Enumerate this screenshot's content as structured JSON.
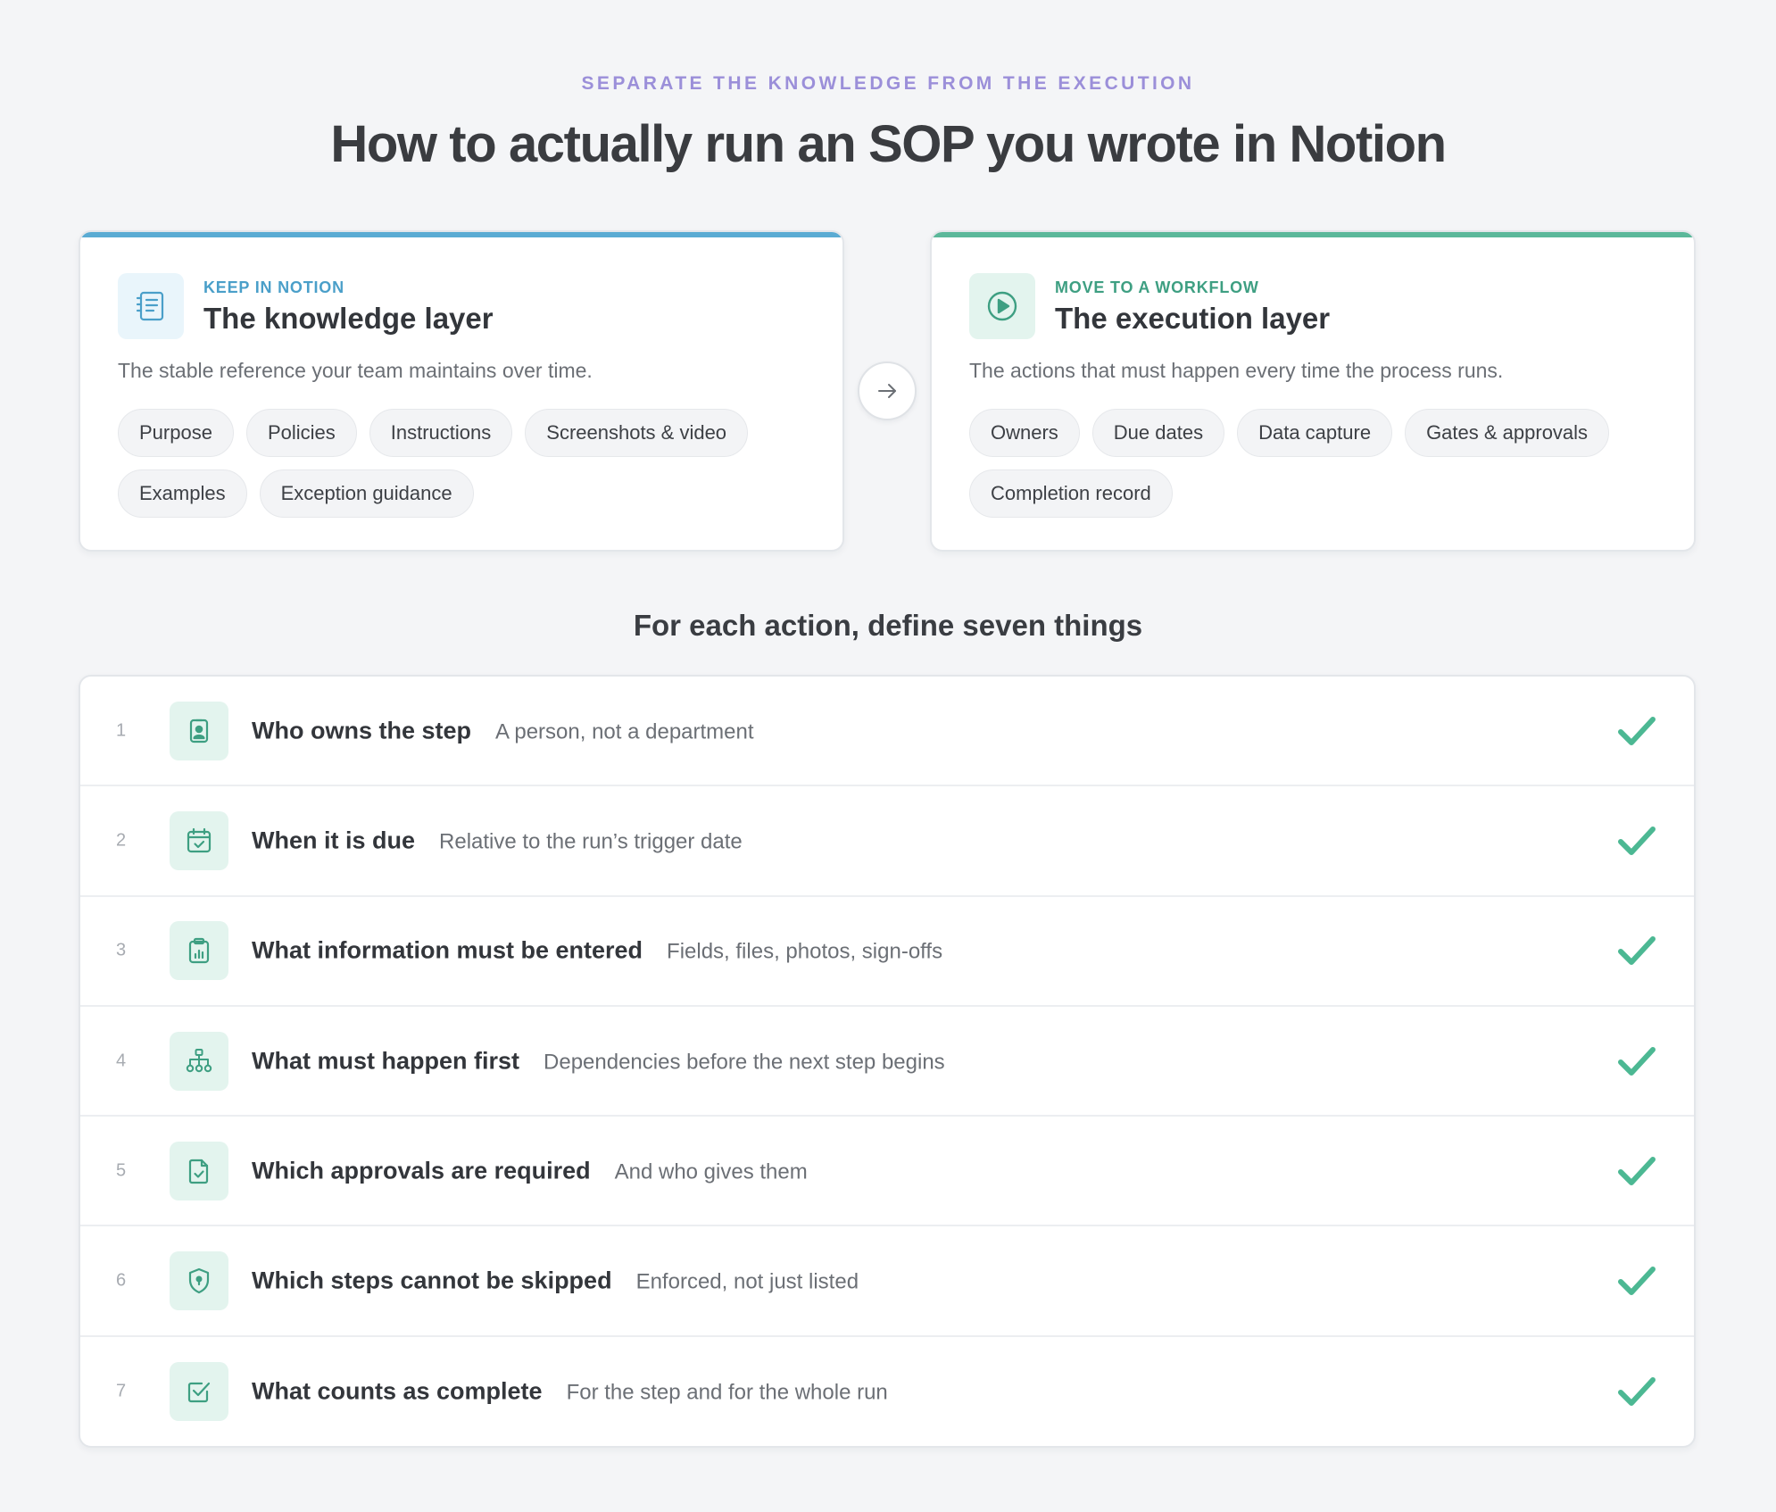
{
  "header": {
    "eyebrow": "SEPARATE THE KNOWLEDGE FROM THE EXECUTION",
    "title": "How to actually run an SOP you wrote in Notion"
  },
  "knowledge_card": {
    "kicker": "KEEP IN NOTION",
    "title": "The knowledge layer",
    "description": "The stable reference your team maintains over time.",
    "icon": "document-list-icon",
    "accent": "#5aabd3",
    "chips": [
      "Purpose",
      "Policies",
      "Instructions",
      "Screenshots & video",
      "Examples",
      "Exception guidance"
    ]
  },
  "arrow": {
    "icon": "arrow-right-icon"
  },
  "execution_card": {
    "kicker": "MOVE TO A WORKFLOW",
    "title": "The execution layer",
    "description": "The actions that must happen every time the process runs.",
    "icon": "play-circle-icon",
    "accent": "#5bb89a",
    "chips": [
      "Owners",
      "Due dates",
      "Data capture",
      "Gates & approvals",
      "Completion record"
    ]
  },
  "section": {
    "title": "For each action, define seven things"
  },
  "items": [
    {
      "number": "1",
      "icon": "person-badge-icon",
      "title": "Who owns the step",
      "subtitle": "A person, not a department"
    },
    {
      "number": "2",
      "icon": "calendar-check-icon",
      "title": "When it is due",
      "subtitle": "Relative to the run’s trigger date"
    },
    {
      "number": "3",
      "icon": "clipboard-chart-icon",
      "title": "What information must be entered",
      "subtitle": "Fields, files, photos, sign-offs"
    },
    {
      "number": "4",
      "icon": "hierarchy-icon",
      "title": "What must happen first",
      "subtitle": "Dependencies before the next step begins"
    },
    {
      "number": "5",
      "icon": "file-check-icon",
      "title": "Which approvals are required",
      "subtitle": "And who gives them"
    },
    {
      "number": "6",
      "icon": "shield-lock-icon",
      "title": "Which steps cannot be skipped",
      "subtitle": "Enforced, not just listed"
    },
    {
      "number": "7",
      "icon": "checkbox-icon",
      "title": "What counts as complete",
      "subtitle": "For the step and for the whole run"
    }
  ],
  "colors": {
    "eyebrow": "#9b8fd9",
    "teal": "#3e9f82",
    "check": "#4cb893",
    "blue": "#4a9fc9"
  }
}
